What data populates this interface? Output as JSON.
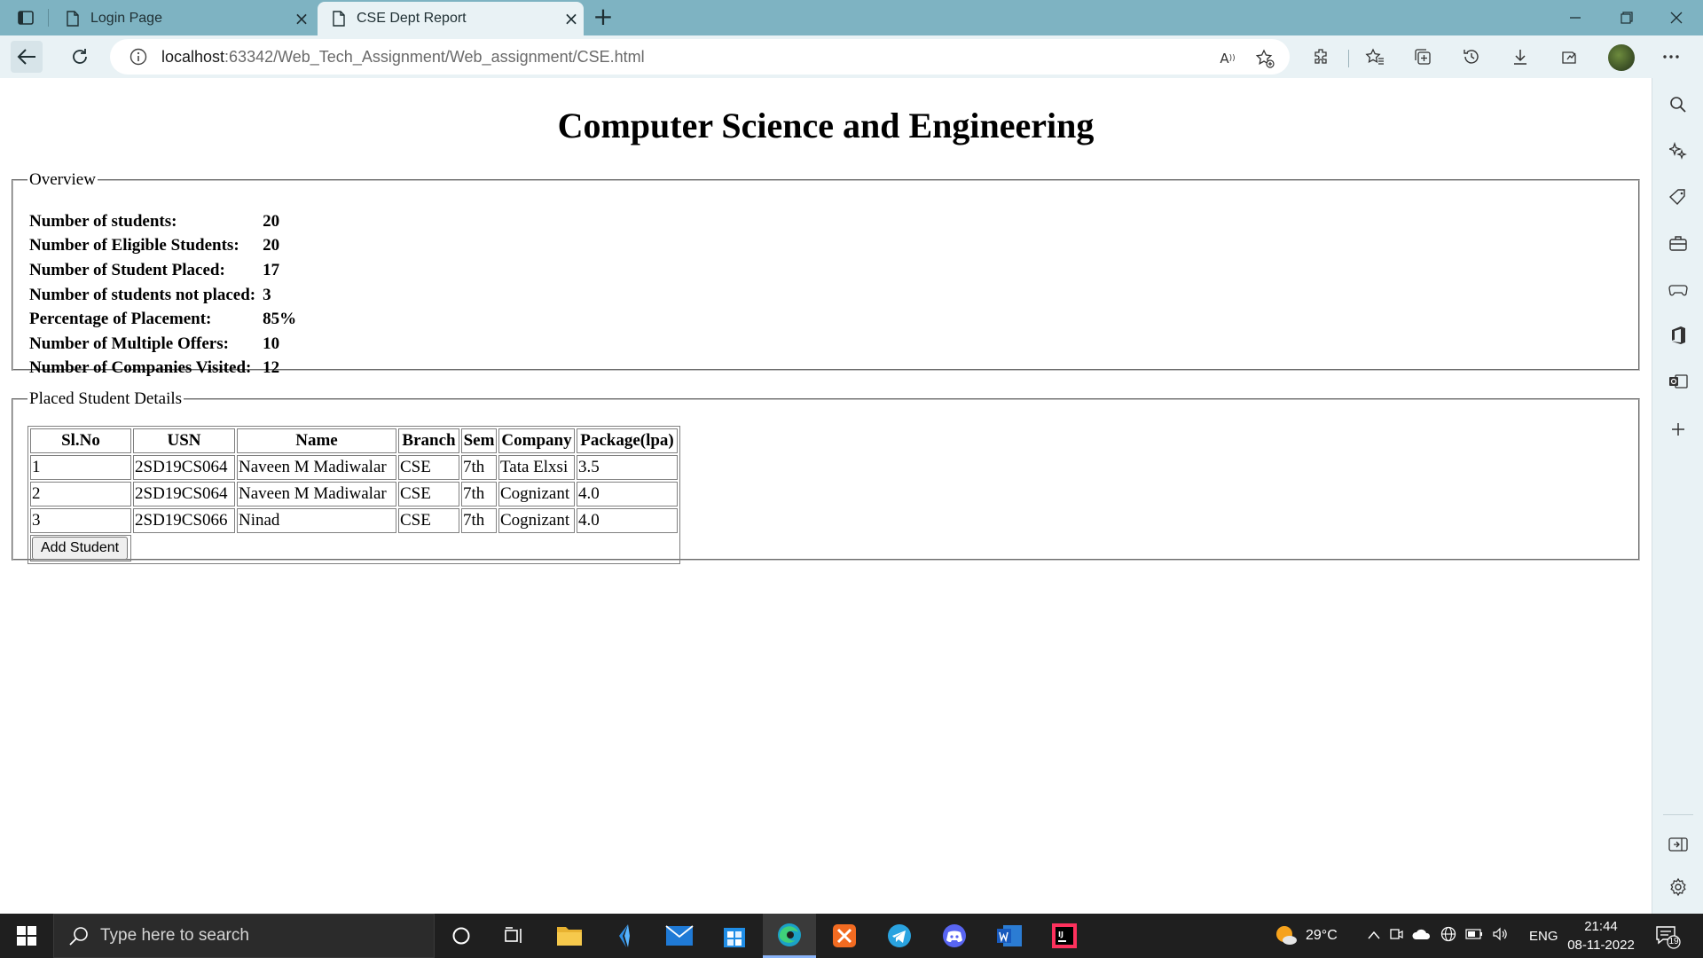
{
  "browser": {
    "tabs": [
      {
        "title": "Login Page",
        "active": false
      },
      {
        "title": "CSE Dept Report",
        "active": true
      }
    ],
    "url_host": "localhost",
    "url_path": ":63342/Web_Tech_Assignment/Web_assignment/CSE.html",
    "read_aloud_label": "A",
    "icons": [
      "tab-actions-icon",
      "page-icon",
      "close-icon",
      "plus-icon",
      "minimize-icon",
      "restore-icon",
      "close-window-icon",
      "back-arrow-icon",
      "refresh-icon",
      "info-icon",
      "read-aloud-icon",
      "add-favorite-icon",
      "extensions-icon",
      "favorites-icon",
      "collections-icon",
      "history-icon",
      "download-icon",
      "performance-icon",
      "profile-avatar",
      "more-icon"
    ],
    "sidebar_icons": [
      "search-icon",
      "copilot-icon",
      "shopping-tag-icon",
      "tools-icon",
      "games-icon",
      "office-icon",
      "outlook-icon",
      "add-icon",
      "hide-sidebar-icon",
      "settings-icon"
    ]
  },
  "page": {
    "title": "Computer Science and Engineering",
    "overview": {
      "legend": "Overview",
      "stats": [
        {
          "label": "Number of students:",
          "value": "20"
        },
        {
          "label": "Number of Eligible Students:",
          "value": "20"
        },
        {
          "label": "Number of Student Placed:",
          "value": "17"
        },
        {
          "label": "Number of students not placed:",
          "value": "3"
        },
        {
          "label": "Percentage of Placement:",
          "value": "85%"
        },
        {
          "label": "Number of Multiple Offers:",
          "value": "10"
        },
        {
          "label": "Number of Companies Visited:",
          "value": "12"
        }
      ]
    },
    "placed": {
      "legend": "Placed Student Details",
      "columns": [
        "Sl.No",
        "USN",
        "Name",
        "Branch",
        "Sem",
        "Company",
        "Package(lpa)"
      ],
      "rows": [
        [
          "1",
          "2SD19CS064",
          "Naveen M Madiwalar",
          "CSE",
          "7th",
          "Tata Elxsi",
          "3.5"
        ],
        [
          "2",
          "2SD19CS064",
          "Naveen M Madiwalar",
          "CSE",
          "7th",
          "Cognizant",
          "4.0"
        ],
        [
          "3",
          "2SD19CS066",
          "Ninad",
          "CSE",
          "7th",
          "Cognizant",
          "4.0"
        ]
      ],
      "add_button": "Add Student"
    }
  },
  "taskbar": {
    "search_placeholder": "Type here to search",
    "apps": [
      "cortana-icon",
      "task-view-icon",
      "file-explorer-icon",
      "visual-studio-icon",
      "mail-icon",
      "store-icon",
      "edge-icon",
      "xampp-icon",
      "telegram-icon",
      "discord-icon",
      "word-icon",
      "intellij-icon"
    ],
    "weather_temp": "29°C",
    "language": "ENG",
    "time": "21:44",
    "date": "08-11-2022",
    "notification_count": "19"
  },
  "colors": {
    "tabstrip": "#7eb3c2",
    "toolbar": "#e9f2f5",
    "taskbar": "#1f1f1f"
  }
}
